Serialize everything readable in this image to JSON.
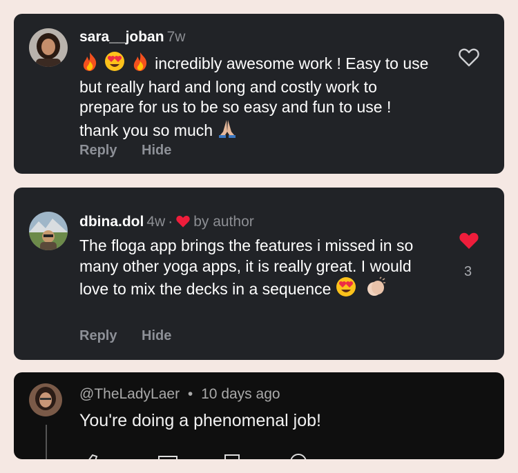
{
  "comments": [
    {
      "username": "sara__joban",
      "age": "7w",
      "text": "incredibly awesome work ! Easy to use but really hard and long and costly work to prepare for us to be so easy and fun to use ! thank you so much",
      "reply_label": "Reply",
      "hide_label": "Hide"
    },
    {
      "username": "dbina.dol",
      "age": "4w",
      "separator": "·",
      "by_author": "by author",
      "text": "The floga app brings the features i missed in so many other yoga apps, it is really great. I would love to mix the decks in a sequence",
      "like_count": "3",
      "reply_label": "Reply",
      "hide_label": "Hide"
    }
  ],
  "youtube_comment": {
    "handle": "@TheLadyLaer",
    "separator": "•",
    "age": "10 days ago",
    "text": "You're doing a phenomenal job!"
  },
  "colors": {
    "background": "#f5e8e3",
    "card": "#212327",
    "youtube_card": "#0f0f0f",
    "heart_red": "#ee1d3b",
    "muted": "#8d9097"
  }
}
